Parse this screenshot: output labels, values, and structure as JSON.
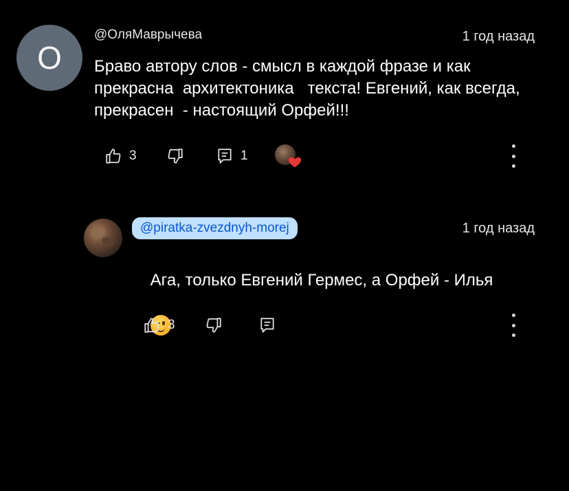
{
  "comments": [
    {
      "author": "@ОляМаврычева",
      "avatar_letter": "О",
      "time": "1 год назад",
      "text": "Браво автору слов - смысл в каждой фразе и как прекрасна  архитектоника   текста! Евгений, как всегда, прекрасен  - настоящий Орфей!!!",
      "likes": "3",
      "replies": "1",
      "icons": {
        "like": "thumbs-up-icon",
        "dislike": "thumbs-down-icon",
        "reply": "reply-icon",
        "heart": "creator-heart-icon",
        "more": "more-vert-icon"
      }
    },
    {
      "author": "@piratka-zvezdnyh-morej",
      "time": "1 год назад",
      "text": "Ага, только Евгений Гермес, а Орфей - Илья",
      "emoji": "winking-face-emoji",
      "likes": "3",
      "icons": {
        "like": "thumbs-up-icon",
        "dislike": "thumbs-down-icon",
        "reply": "reply-icon",
        "more": "more-vert-icon"
      }
    }
  ],
  "colors": {
    "background": "#000000",
    "text": "#ffffff",
    "secondary_text": "#e6e6e6",
    "mention_bg": "#bfe0ff",
    "mention_text": "#0b57d0",
    "heart": "#e53935",
    "avatar_letter_bg": "#5f6a77"
  }
}
